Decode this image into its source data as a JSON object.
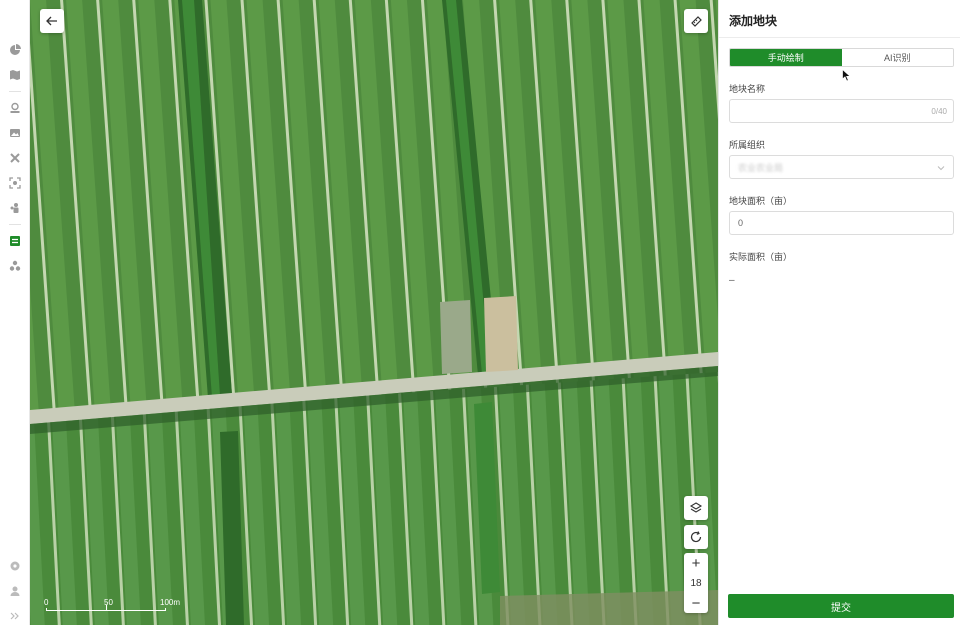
{
  "sidebar": {
    "icons": [
      "pie-chart-icon",
      "map-icon",
      "user-location-icon",
      "image-icon",
      "tools-icon",
      "scan-icon",
      "people-icon",
      "list-icon",
      "cluster-icon",
      "settings-icon",
      "user-icon",
      "expand-icon"
    ]
  },
  "map": {
    "zoom_level": "18",
    "zoom_in": "+",
    "zoom_out": "−",
    "scale": {
      "l0": "0",
      "l1": "50",
      "l2": "100m"
    }
  },
  "panel": {
    "title": "添加地块",
    "tabs": {
      "manual": "手动绘制",
      "ai": "AI识别"
    },
    "fields": {
      "name_label": "地块名称",
      "name_count": "0/40",
      "org_label": "所属组织",
      "org_value": "农业农业局",
      "area_label": "地块面积（亩）",
      "area_value": "0",
      "actual_label": "实际面积（亩）",
      "actual_value": "–"
    },
    "submit": "提交"
  },
  "colors": {
    "accent": "#1f8c2a"
  }
}
